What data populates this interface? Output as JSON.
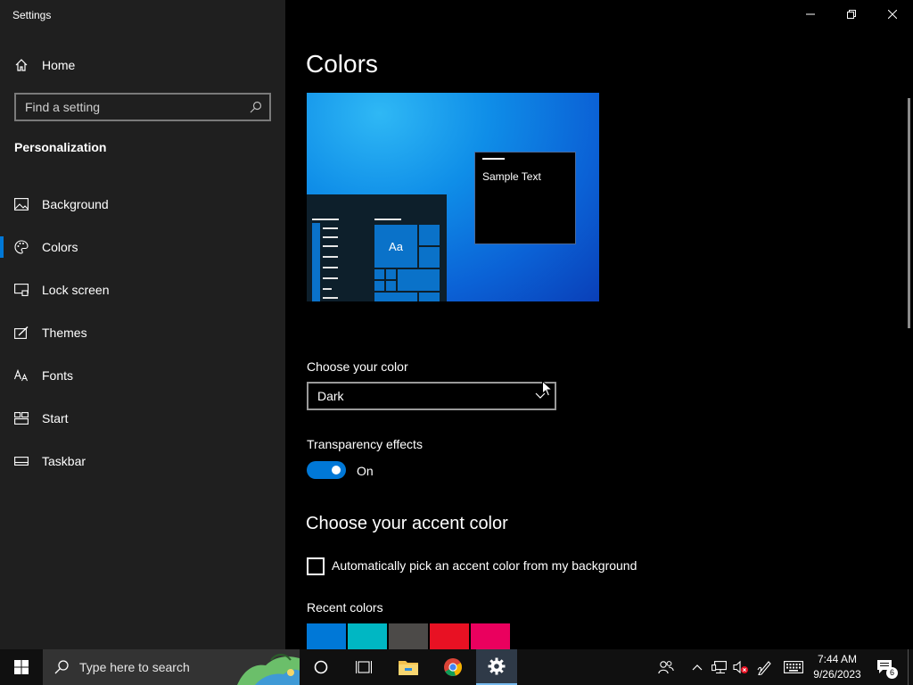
{
  "window": {
    "title": "Settings"
  },
  "sidebar": {
    "home_label": "Home",
    "search_placeholder": "Find a setting",
    "section_title": "Personalization",
    "items": [
      {
        "label": "Background",
        "icon": "image-icon"
      },
      {
        "label": "Colors",
        "icon": "palette-icon",
        "selected": true
      },
      {
        "label": "Lock screen",
        "icon": "lock-screen-icon"
      },
      {
        "label": "Themes",
        "icon": "themes-icon"
      },
      {
        "label": "Fonts",
        "icon": "fonts-icon"
      },
      {
        "label": "Start",
        "icon": "start-icon"
      },
      {
        "label": "Taskbar",
        "icon": "taskbar-icon"
      }
    ]
  },
  "main": {
    "title": "Colors",
    "preview": {
      "sample_text": "Sample Text",
      "tile_text": "Aa"
    },
    "choose_color": {
      "label": "Choose your color",
      "selected": "Dark"
    },
    "transparency": {
      "label": "Transparency effects",
      "state": "On",
      "enabled": true
    },
    "accent": {
      "heading": "Choose your accent color",
      "auto_label": "Automatically pick an accent color from my background",
      "auto_checked": false,
      "recent_label": "Recent colors",
      "recent_colors": [
        "#0078d7",
        "#00b7c3",
        "#4c4a48",
        "#e81123",
        "#ea005e"
      ]
    }
  },
  "taskbar": {
    "search_placeholder": "Type here to search",
    "time": "7:44 AM",
    "date": "9/26/2023",
    "notification_count": "6"
  },
  "colors": {
    "accent": "#0078d7",
    "sidebar_bg": "#1f1f1f",
    "content_bg": "#000000",
    "taskbar_bg": "#101010"
  }
}
